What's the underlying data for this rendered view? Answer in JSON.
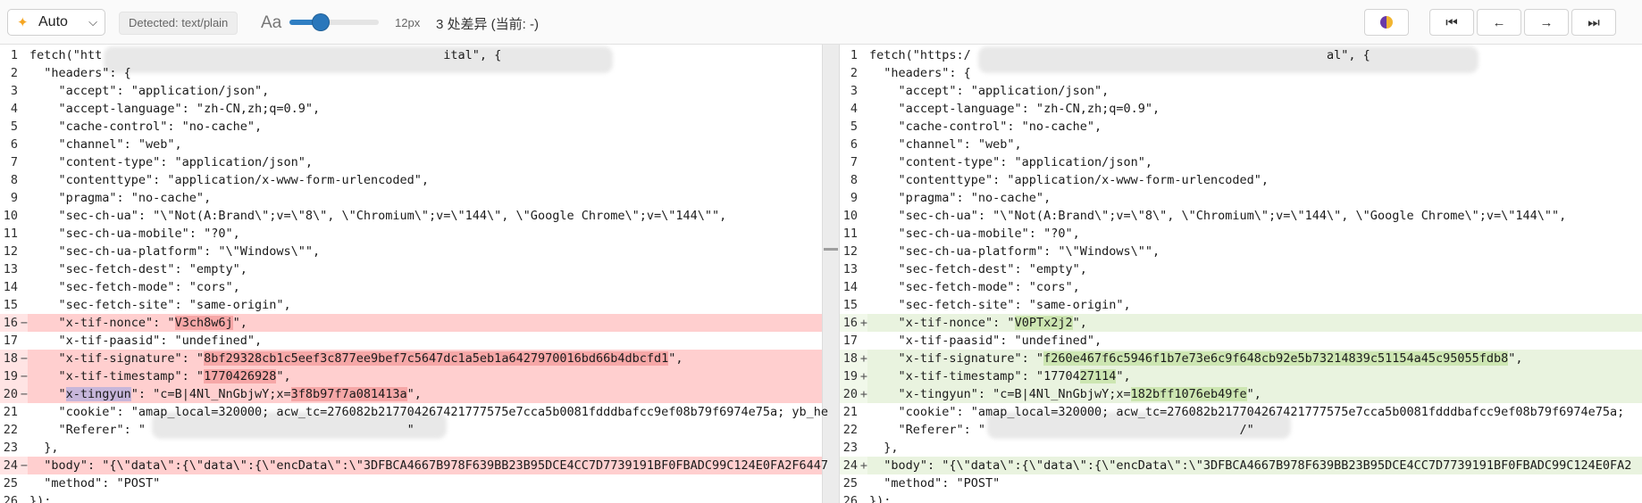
{
  "toolbar": {
    "mode": "Auto",
    "detected": "Detected: text/plain",
    "font_icon": "Aa",
    "font_size": "12px",
    "font_slider_percent": 35,
    "diff_count": "3 处差异 (当前: -)",
    "theme_icon": "half-circle-theme-icon",
    "nav": [
      "⏮",
      "←",
      "→",
      "⏭"
    ]
  },
  "left": {
    "lines": [
      {
        "n": "1",
        "mark": "",
        "type": "",
        "code": "fetch(\"htt                                               ital\", {"
      },
      {
        "n": "2",
        "mark": "",
        "type": "",
        "code": "  \"headers\": {"
      },
      {
        "n": "3",
        "mark": "",
        "type": "",
        "code": "    \"accept\": \"application/json\","
      },
      {
        "n": "4",
        "mark": "",
        "type": "",
        "code": "    \"accept-language\": \"zh-CN,zh;q=0.9\","
      },
      {
        "n": "5",
        "mark": "",
        "type": "",
        "code": "    \"cache-control\": \"no-cache\","
      },
      {
        "n": "6",
        "mark": "",
        "type": "",
        "code": "    \"channel\": \"web\","
      },
      {
        "n": "7",
        "mark": "",
        "type": "",
        "code": "    \"content-type\": \"application/json\","
      },
      {
        "n": "8",
        "mark": "",
        "type": "",
        "code": "    \"contenttype\": \"application/x-www-form-urlencoded\","
      },
      {
        "n": "9",
        "mark": "",
        "type": "",
        "code": "    \"pragma\": \"no-cache\","
      },
      {
        "n": "10",
        "mark": "",
        "type": "",
        "code": "    \"sec-ch-ua\": \"\\\"Not(A:Brand\\\";v=\\\"8\\\", \\\"Chromium\\\";v=\\\"144\\\", \\\"Google Chrome\\\";v=\\\"144\\\"\","
      },
      {
        "n": "11",
        "mark": "",
        "type": "",
        "code": "    \"sec-ch-ua-mobile\": \"?0\","
      },
      {
        "n": "12",
        "mark": "",
        "type": "",
        "code": "    \"sec-ch-ua-platform\": \"\\\"Windows\\\"\","
      },
      {
        "n": "13",
        "mark": "",
        "type": "",
        "code": "    \"sec-fetch-dest\": \"empty\","
      },
      {
        "n": "14",
        "mark": "",
        "type": "",
        "code": "    \"sec-fetch-mode\": \"cors\","
      },
      {
        "n": "15",
        "mark": "",
        "type": "",
        "code": "    \"sec-fetch-site\": \"same-origin\","
      },
      {
        "n": "16",
        "mark": "−",
        "type": "del",
        "pre": "    \"x-tif-nonce\": \"",
        "hl": "V3ch8w6j",
        "post": "\","
      },
      {
        "n": "17",
        "mark": "",
        "type": "",
        "code": "    \"x-tif-paasid\": \"undefined\","
      },
      {
        "n": "18",
        "mark": "−",
        "type": "del",
        "pre": "    \"x-tif-signature\": \"",
        "hl": "8bf29328cb1c5eef3c877ee9bef7c5647dc1a5eb1a6427970016bd66b4dbcfd1",
        "post": "\","
      },
      {
        "n": "19",
        "mark": "−",
        "type": "del",
        "pre": "    \"x-tif-timestamp\": \"",
        "hl": "1770426928",
        "post": "\","
      },
      {
        "n": "20",
        "mark": "−",
        "type": "del",
        "pre": "    \"",
        "key": "x-tingyun",
        "mid": "\": \"c=B|4Nl_NnGbjwY;x=",
        "hl": "3f8b97f7a081413a",
        "post": "\","
      },
      {
        "n": "21",
        "mark": "",
        "type": "",
        "code": "    \"cookie\": \"amap_local=320000; acw_tc=276082b217704267421777575e7cca5b0081fdddbafcc9ef08b79f6974e75a; yb_he"
      },
      {
        "n": "22",
        "mark": "",
        "type": "",
        "code": "    \"Referer\": \"                                    \""
      },
      {
        "n": "23",
        "mark": "",
        "type": "",
        "code": "  },"
      },
      {
        "n": "24",
        "mark": "−",
        "type": "del",
        "code": "  \"body\": \"{\\\"data\\\":{\\\"data\\\":{\\\"encData\\\":\\\"3DFBCA4667B978F639BB23B95DCE4CC7D7739191BF0FBADC99C124E0FA2F6447"
      },
      {
        "n": "25",
        "mark": "",
        "type": "",
        "code": "  \"method\": \"POST\""
      },
      {
        "n": "26",
        "mark": "",
        "type": "",
        "code": "});"
      }
    ]
  },
  "right": {
    "lines": [
      {
        "n": "1",
        "mark": "",
        "type": "",
        "code": "fetch(\"https:/                                                 al\", {"
      },
      {
        "n": "2",
        "mark": "",
        "type": "",
        "code": "  \"headers\": {"
      },
      {
        "n": "3",
        "mark": "",
        "type": "",
        "code": "    \"accept\": \"application/json\","
      },
      {
        "n": "4",
        "mark": "",
        "type": "",
        "code": "    \"accept-language\": \"zh-CN,zh;q=0.9\","
      },
      {
        "n": "5",
        "mark": "",
        "type": "",
        "code": "    \"cache-control\": \"no-cache\","
      },
      {
        "n": "6",
        "mark": "",
        "type": "",
        "code": "    \"channel\": \"web\","
      },
      {
        "n": "7",
        "mark": "",
        "type": "",
        "code": "    \"content-type\": \"application/json\","
      },
      {
        "n": "8",
        "mark": "",
        "type": "",
        "code": "    \"contenttype\": \"application/x-www-form-urlencoded\","
      },
      {
        "n": "9",
        "mark": "",
        "type": "",
        "code": "    \"pragma\": \"no-cache\","
      },
      {
        "n": "10",
        "mark": "",
        "type": "",
        "code": "    \"sec-ch-ua\": \"\\\"Not(A:Brand\\\";v=\\\"8\\\", \\\"Chromium\\\";v=\\\"144\\\", \\\"Google Chrome\\\";v=\\\"144\\\"\","
      },
      {
        "n": "11",
        "mark": "",
        "type": "",
        "code": "    \"sec-ch-ua-mobile\": \"?0\","
      },
      {
        "n": "12",
        "mark": "",
        "type": "",
        "code": "    \"sec-ch-ua-platform\": \"\\\"Windows\\\"\","
      },
      {
        "n": "13",
        "mark": "",
        "type": "",
        "code": "    \"sec-fetch-dest\": \"empty\","
      },
      {
        "n": "14",
        "mark": "",
        "type": "",
        "code": "    \"sec-fetch-mode\": \"cors\","
      },
      {
        "n": "15",
        "mark": "",
        "type": "",
        "code": "    \"sec-fetch-site\": \"same-origin\","
      },
      {
        "n": "16",
        "mark": "+",
        "type": "add",
        "pre": "    \"x-tif-nonce\": \"",
        "hl": "V0PTx2j2",
        "post": "\","
      },
      {
        "n": "17",
        "mark": "",
        "type": "",
        "code": "    \"x-tif-paasid\": \"undefined\","
      },
      {
        "n": "18",
        "mark": "+",
        "type": "add",
        "pre": "    \"x-tif-signature\": \"",
        "hl": "f260e467f6c5946f1b7e73e6c9f648cb92e5b73214839c51154a45c95055fdb8",
        "post": "\","
      },
      {
        "n": "19",
        "mark": "+",
        "type": "add",
        "pre": "    \"x-tif-timestamp\": \"17704",
        "hl": "27114",
        "post": "\","
      },
      {
        "n": "20",
        "mark": "+",
        "type": "add",
        "pre": "    \"x-tingyun\": \"c=B|4Nl_NnGbjwY;x=",
        "hl": "182bff1076eb49fe",
        "post": "\","
      },
      {
        "n": "21",
        "mark": "",
        "type": "",
        "code": "    \"cookie\": \"amap_local=320000; acw_tc=276082b217704267421777575e7cca5b0081fdddbafcc9ef08b79f6974e75a;"
      },
      {
        "n": "22",
        "mark": "",
        "type": "",
        "code": "    \"Referer\": \"                                   /\""
      },
      {
        "n": "23",
        "mark": "",
        "type": "",
        "code": "  },"
      },
      {
        "n": "24",
        "mark": "+",
        "type": "add",
        "code": "  \"body\": \"{\\\"data\\\":{\\\"data\\\":{\\\"encData\\\":\\\"3DFBCA4667B978F639BB23B95DCE4CC7D7739191BF0FBADC99C124E0FA2"
      },
      {
        "n": "25",
        "mark": "",
        "type": "",
        "code": "  \"method\": \"POST\""
      },
      {
        "n": "26",
        "mark": "",
        "type": "",
        "code": "});"
      }
    ]
  }
}
